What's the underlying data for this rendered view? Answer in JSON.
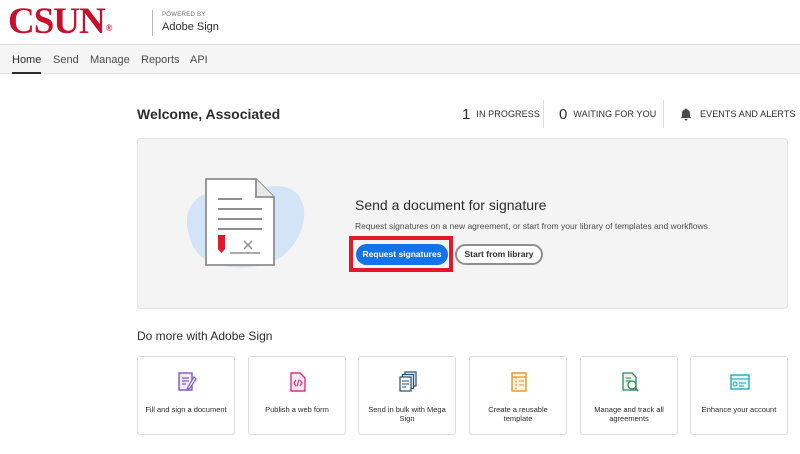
{
  "header": {
    "logo_text": "CSUN",
    "logo_mark": "®",
    "powered_by": "POWERED BY",
    "brand": "Adobe Sign"
  },
  "nav": {
    "items": [
      {
        "label": "Home",
        "active": true
      },
      {
        "label": "Send"
      },
      {
        "label": "Manage"
      },
      {
        "label": "Reports"
      },
      {
        "label": "API"
      }
    ]
  },
  "welcome": "Welcome, Associated",
  "stats": {
    "in_progress": {
      "count": "1",
      "label": "IN PROGRESS"
    },
    "waiting": {
      "count": "0",
      "label": "WAITING FOR YOU"
    },
    "events": {
      "label": "EVENTS AND ALERTS",
      "icon": "bell-icon"
    }
  },
  "hero": {
    "title": "Send a document for signature",
    "description": "Request signatures on a new agreement, or start from your library of templates and workflows.",
    "primary_button": "Request signatures",
    "secondary_button": "Start from library"
  },
  "more": {
    "title": "Do more with Adobe Sign",
    "cards": [
      {
        "label": "Fill and sign a document",
        "icon": "fill-sign-icon",
        "color": "#7e57c2"
      },
      {
        "label": "Publish a web form",
        "icon": "web-form-icon",
        "color": "#d63384"
      },
      {
        "label": "Send in bulk with Mega Sign",
        "icon": "mega-sign-icon",
        "color": "#1f4e79"
      },
      {
        "label": "Create a reusable template",
        "icon": "template-icon",
        "color": "#e8951f"
      },
      {
        "label": "Manage and track all agreements",
        "icon": "manage-track-icon",
        "color": "#2e8b57"
      },
      {
        "label": "Enhance your account",
        "icon": "enhance-account-icon",
        "color": "#17a2b8"
      }
    ]
  },
  "colors": {
    "brand_red": "#c8102e",
    "primary_blue": "#1473e6",
    "highlight_red": "#e2182d"
  }
}
